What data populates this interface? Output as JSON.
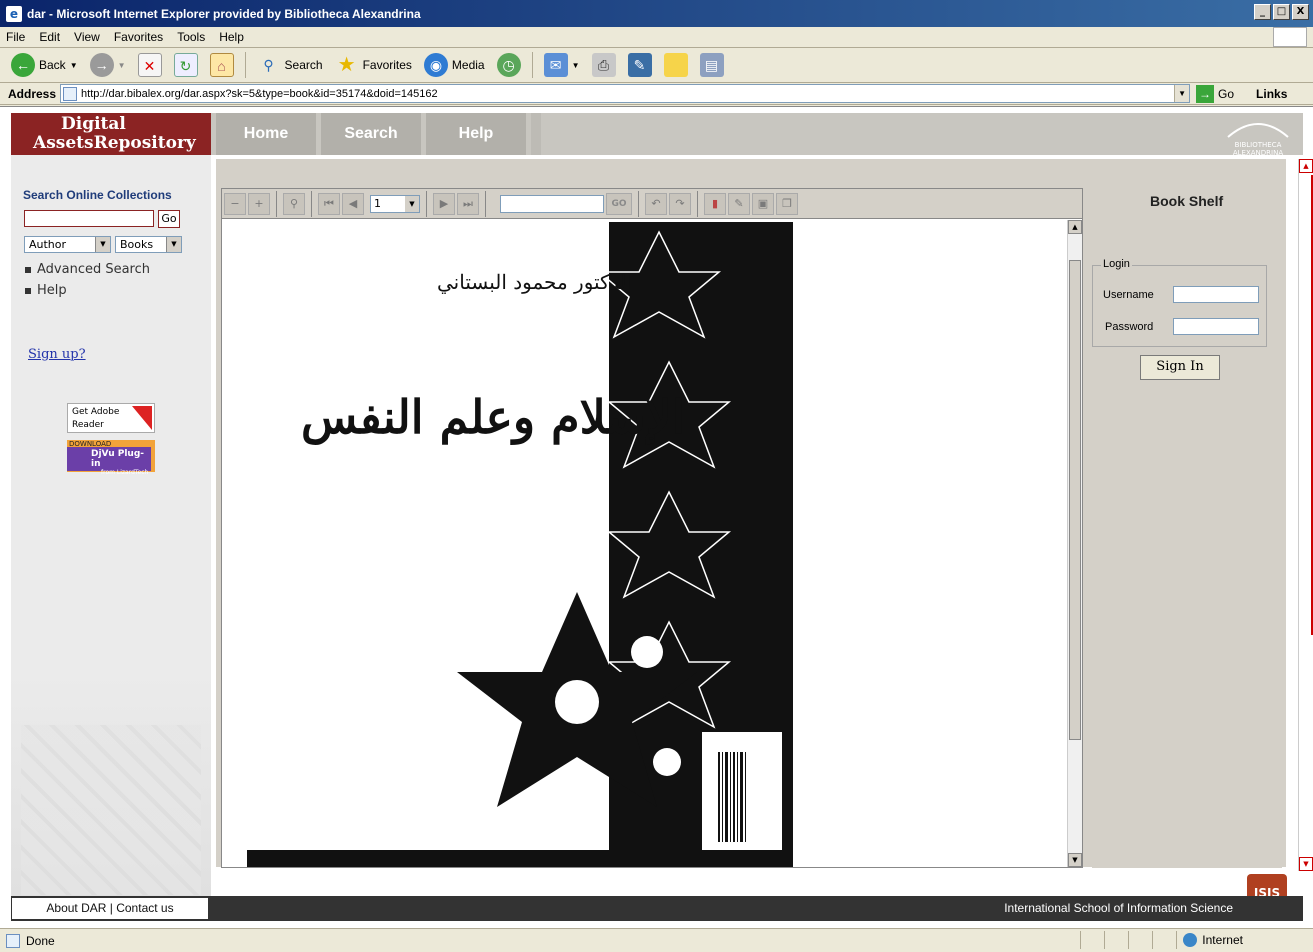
{
  "window": {
    "title": "dar - Microsoft Internet Explorer provided by Bibliotheca Alexandrina",
    "minimize": "_",
    "maximize": "□",
    "close": "X"
  },
  "menu": [
    "File",
    "Edit",
    "View",
    "Favorites",
    "Tools",
    "Help"
  ],
  "toolbar": {
    "back": "Back",
    "search": "Search",
    "favorites": "Favorites",
    "media": "Media"
  },
  "address": {
    "label": "Address",
    "url": "http://dar.bibalex.org/dar.aspx?sk=5&type=book&id=35174&doid=145162",
    "go": "Go",
    "links": "Links"
  },
  "site": {
    "logo_line1": "Digital",
    "logo_line2": "AssetsRepository",
    "nav": [
      "Home",
      "Search",
      "Help"
    ],
    "partner_logo": "BIBLIOTHECA ALEXANDRINA"
  },
  "sidebar": {
    "title": "Search Online Collections",
    "search_value": "",
    "go": "Go",
    "field_select": "Author",
    "type_select": "Books",
    "links": [
      "Advanced Search",
      "Help"
    ],
    "signup": "Sign up?",
    "adobe_label": "Get Adobe Reader",
    "djvu_download": "DOWNLOAD",
    "djvu_label": "DjVu Plug-in",
    "djvu_sub": "from LizardTech"
  },
  "viewer": {
    "page": "1",
    "go": "GO",
    "cover_author": "الدكتور محمود البستاني",
    "cover_title": "الإسلام وعلم النفس"
  },
  "bookshelf": {
    "title": "Book Shelf",
    "login_legend": "Login",
    "username_label": "Username",
    "password_label": "Password",
    "signin": "Sign In"
  },
  "footer": {
    "about": "About DAR | Contact us",
    "school": "International School of Information Science",
    "logo_text": "ISIS"
  },
  "status": {
    "text": "Done",
    "zone": "Internet"
  }
}
